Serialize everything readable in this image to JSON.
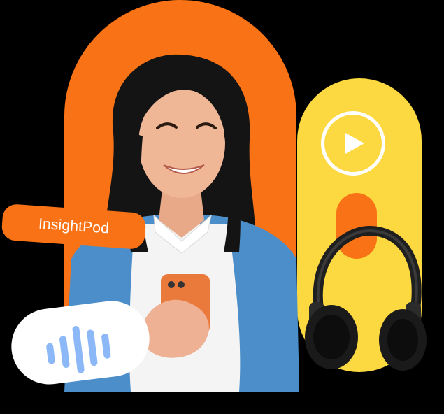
{
  "brand": {
    "name": "InsightPod"
  },
  "colors": {
    "orange": "#F97316",
    "yellow": "#FCD941",
    "white": "#FFFFFF",
    "wave_blue": "#8DB8F8",
    "cardigan_blue": "#4B8EC9"
  },
  "icons": {
    "play": "play-icon",
    "audio_wave": "audio-wave-icon",
    "headphones": "headphones-icon"
  }
}
